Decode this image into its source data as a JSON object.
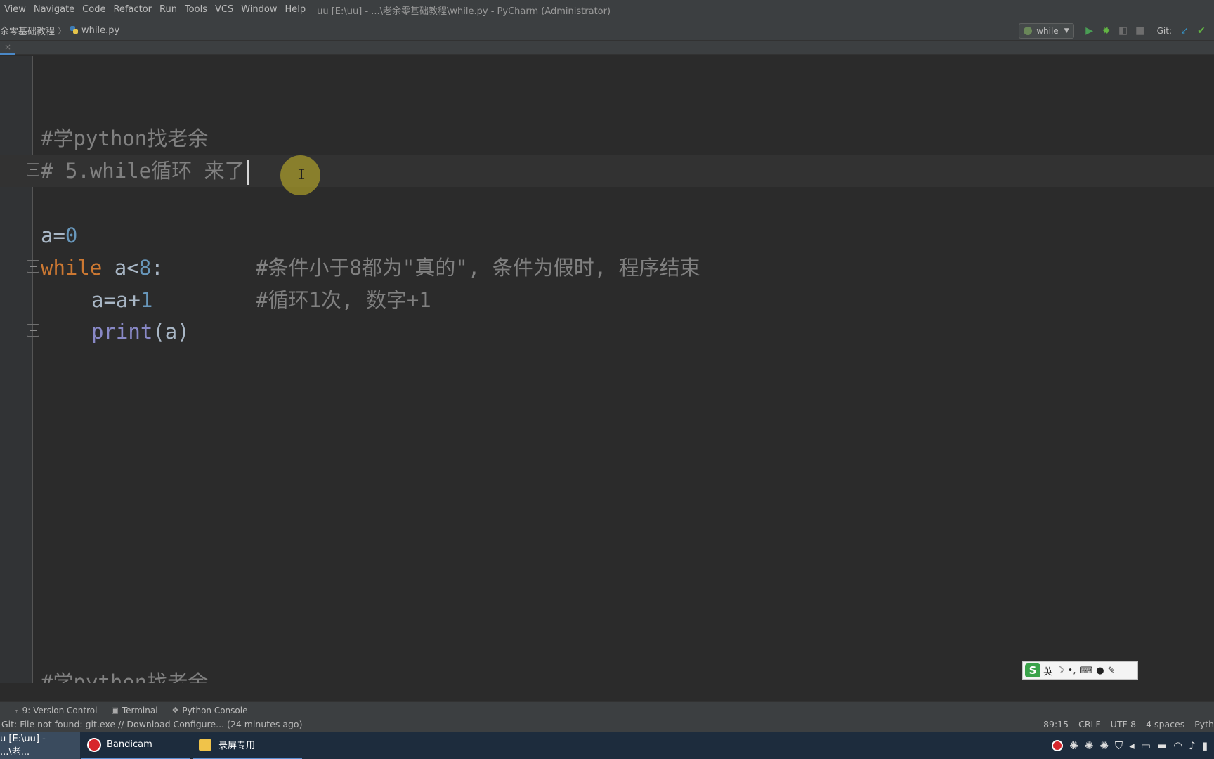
{
  "menubar": {
    "items": [
      "View",
      "Navigate",
      "Code",
      "Refactor",
      "Run",
      "Tools",
      "VCS",
      "Window",
      "Help"
    ],
    "window_title": "uu [E:\\uu] - ...\\老余零基础教程\\while.py - PyCharm (Administrator)"
  },
  "navbar": {
    "folder_crumb": "余零基础教程",
    "file_crumb": "while.py",
    "run_config": "while",
    "git_label": "Git:"
  },
  "editor": {
    "lines": {
      "l1": "#学python找老余",
      "l2": "# 5.while循环 来了",
      "l3_a": "a=",
      "l3_b": "0",
      "l4_kw": "while",
      "l4_a": " a<",
      "l4_b": "8",
      "l4_c": ":",
      "l4_comment": "#条件小于8都为\"真的\", 条件为假时, 程序结束",
      "l5_a": "a=a+",
      "l5_b": "1",
      "l5_comment": "#循环1次, 数字+1",
      "l6_fn": "print",
      "l6_args": "(a)",
      "l7": "#学python找老余"
    }
  },
  "ime": {
    "mode": "英",
    "logo": "S"
  },
  "toolwindows": {
    "version_control": "9: Version Control",
    "terminal": "Terminal",
    "python_console": "Python Console"
  },
  "statusbar": {
    "message": "Git: File not found: git.exe // Download    Configure... (24 minutes ago)",
    "position": "89:15",
    "line_sep": "CRLF",
    "encoding": "UTF-8",
    "indent": "4 spaces",
    "interpreter": "Pyth"
  },
  "taskbar": {
    "pycharm": "u [E:\\uu] - ...\\老...",
    "bandicam": "Bandicam",
    "folder": "录屏专用"
  },
  "colors": {
    "keyword": "#cc7832",
    "number": "#6897bb",
    "comment": "#808080",
    "builtin": "#8888c6",
    "editor_bg": "#2b2b2b"
  }
}
